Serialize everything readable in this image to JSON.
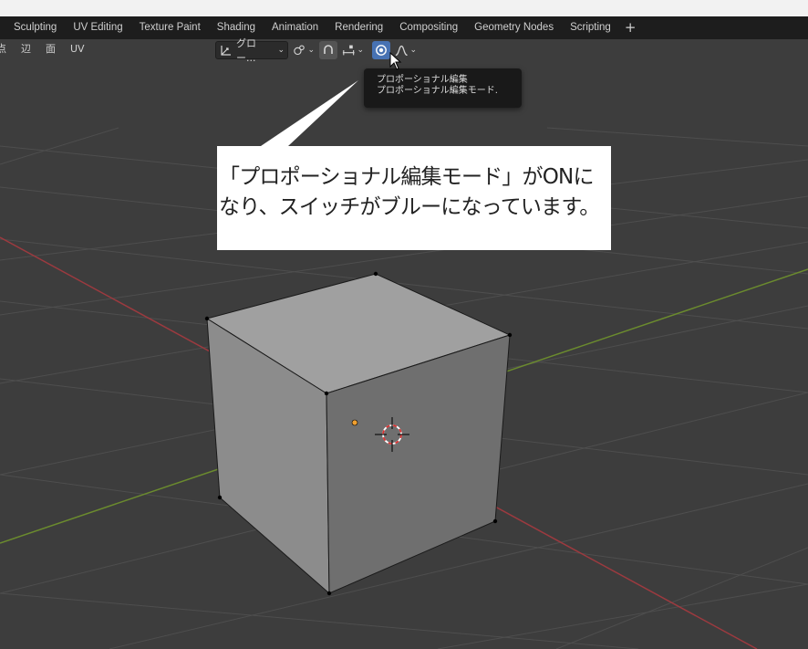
{
  "workspace_tabs": [
    {
      "label": "Sculpting"
    },
    {
      "label": "UV Editing"
    },
    {
      "label": "Texture Paint"
    },
    {
      "label": "Shading"
    },
    {
      "label": "Animation"
    },
    {
      "label": "Rendering"
    },
    {
      "label": "Compositing"
    },
    {
      "label": "Geometry Nodes"
    },
    {
      "label": "Scripting"
    }
  ],
  "workspace_add": "+",
  "viewport_header": {
    "select_modes": [
      {
        "label": "点"
      },
      {
        "label": "辺"
      },
      {
        "label": "面"
      }
    ],
    "uv_menu": "UV",
    "transform_orientation": "グロー...",
    "proportional_edit_active": true
  },
  "tooltip": {
    "title": "プロポーショナル編集",
    "description": "プロポーショナル編集モード."
  },
  "annotation": {
    "line1": "「プロポーショナル編集モード」がONに",
    "line2": "なり、スイッチがブルーになっています。"
  },
  "colors": {
    "active_toggle": "#4772b3",
    "x_axis": "#9c3a3f",
    "y_axis": "#6b8b2e",
    "selection_orange": "#f0a030"
  },
  "icons": [
    "transform-orientation-icon",
    "pivot-point-icon",
    "snap-icon",
    "snap-target-icon",
    "proportional-edit-icon",
    "falloff-curve-icon",
    "mouse-cursor-icon",
    "3d-cursor-icon"
  ]
}
